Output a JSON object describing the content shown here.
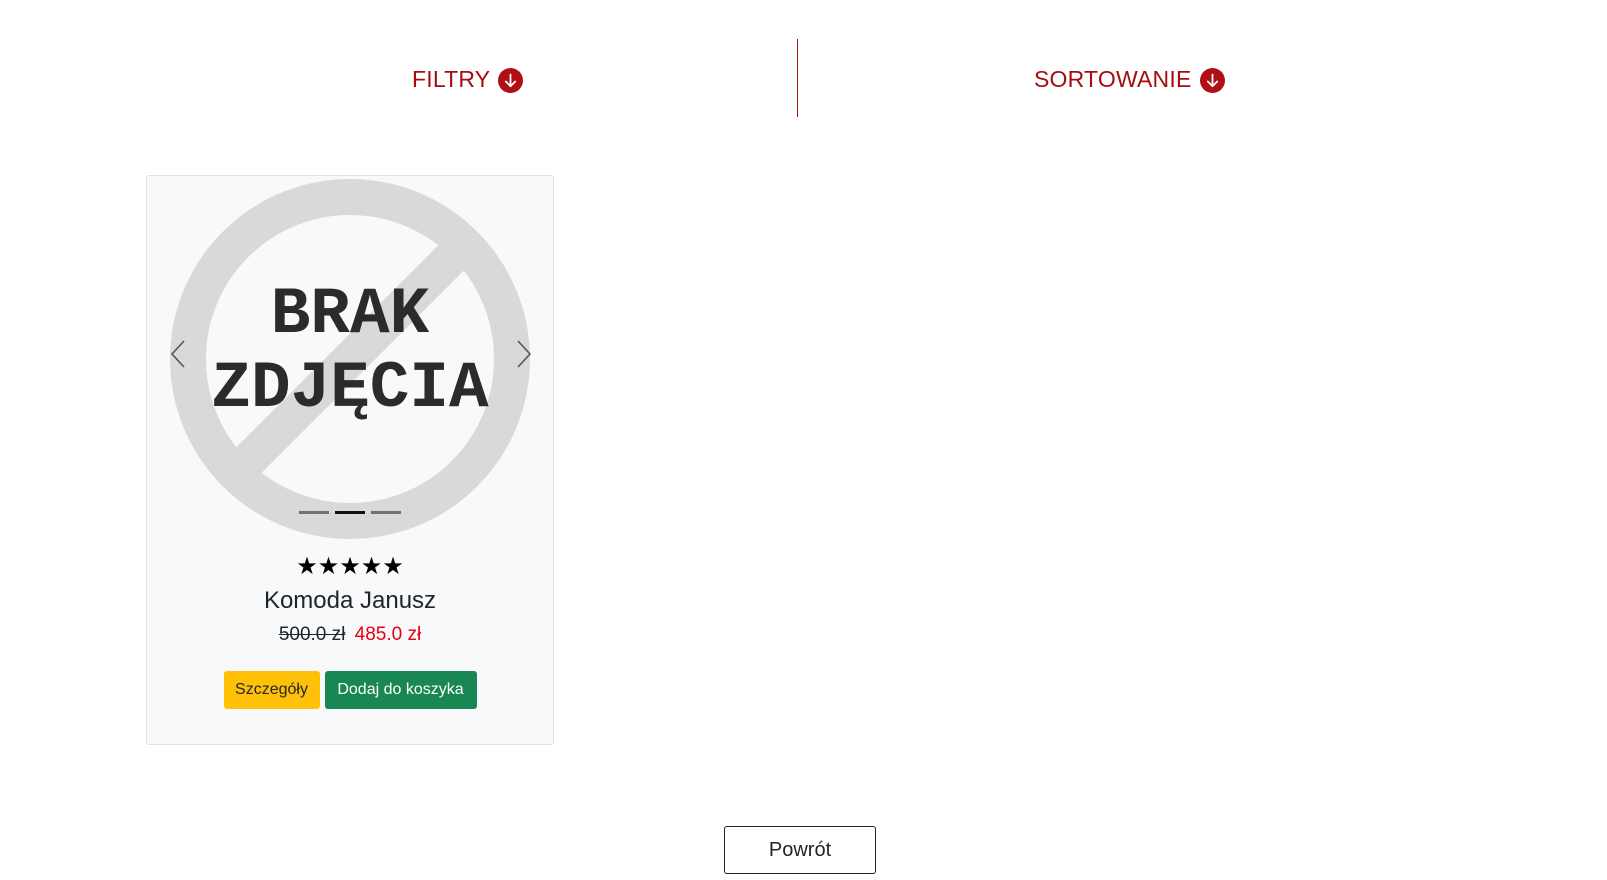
{
  "toolbar": {
    "filters_label": "FILTRY",
    "sorting_label": "SORTOWANIE",
    "filters_icon": "arrow-down-circle-icon",
    "sorting_icon": "arrow-down-circle-icon"
  },
  "product": {
    "image_text_line1": "BRAK",
    "image_text_line2": "ZDJĘCIA",
    "carousel_slide_count": 3,
    "carousel_active_slide": 2,
    "rating_stars": "★★★★★",
    "rating_value": 5,
    "rating_max": 5,
    "name": "Komoda Janusz",
    "old_price": "500.0 zł",
    "new_price": "485.0 zł",
    "details_label": "Szczegóły",
    "add_to_cart_label": "Dodaj do koszyka"
  },
  "footer": {
    "back_label": "Powrót"
  },
  "colors": {
    "accent": "#a50d12",
    "sale_price": "#e3000f",
    "details_button": "#ffc107",
    "cart_button": "#198754"
  }
}
